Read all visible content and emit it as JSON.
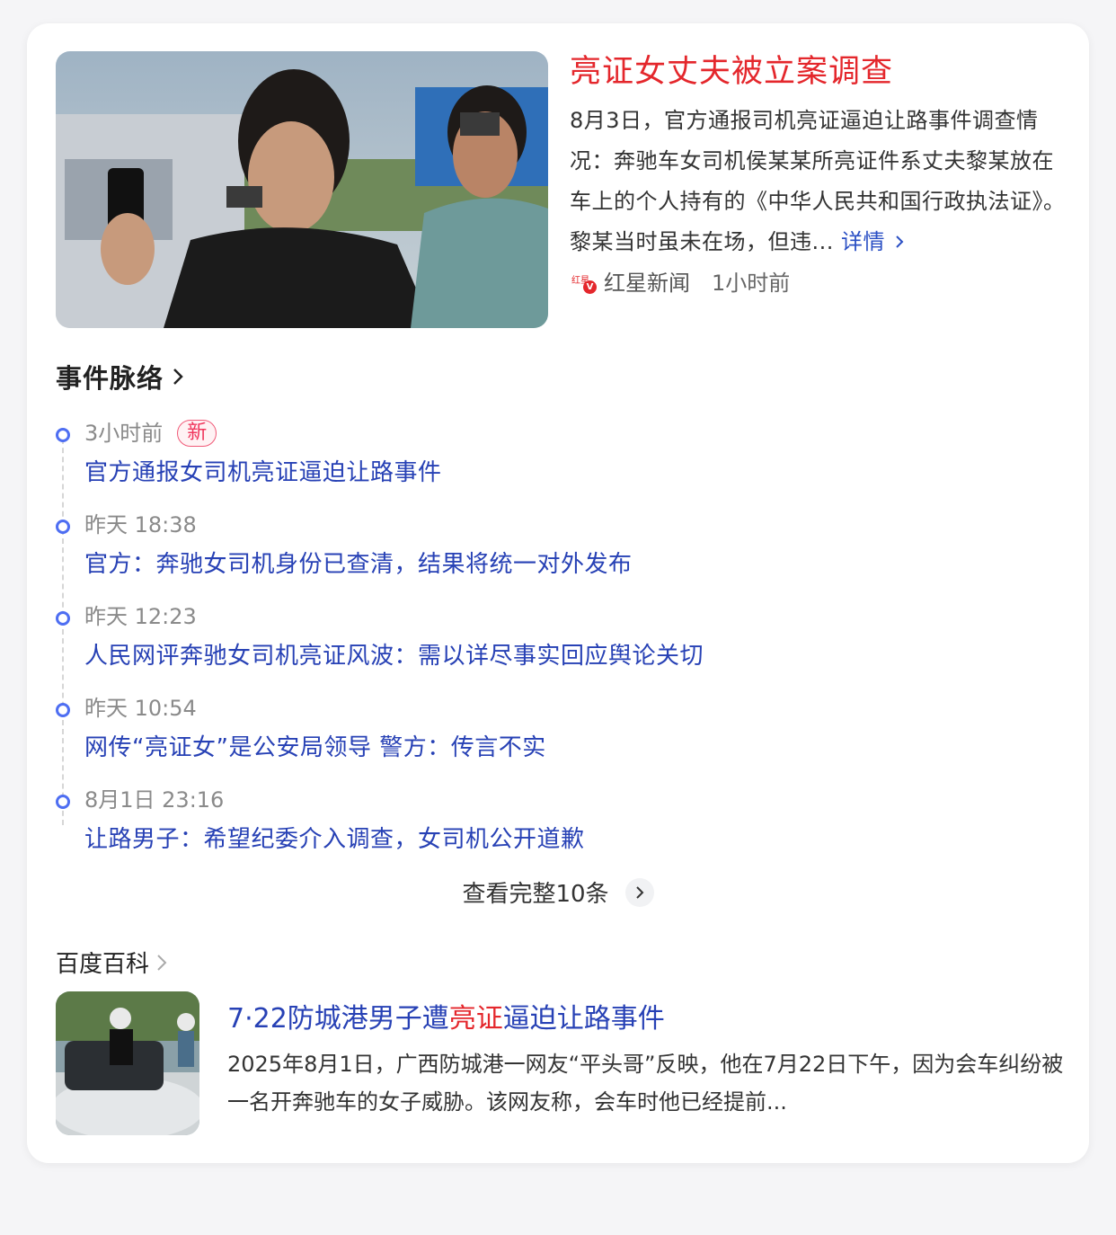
{
  "news": {
    "title": "亮证女丈夫被立案调查",
    "summary": "8月3日，官方通报司机亮证逼迫让路事件调查情况：奔驰车女司机侯某某所亮证件系丈夫黎某放在车上的个人持有的《中华人民共和国行政执法证》。黎某当时虽未在场，但违...",
    "detail_label": "详情",
    "source_name": "红星新闻",
    "time": "1小时前",
    "source_icon": "hongxing-logo-verified-icon"
  },
  "timeline": {
    "heading": "事件脉络",
    "items": [
      {
        "time": "3小时前",
        "badge": "新",
        "text": "官方通报女司机亮证逼迫让路事件"
      },
      {
        "time": "昨天 18:38",
        "text": "官方：奔驰女司机身份已查清，结果将统一对外发布"
      },
      {
        "time": "昨天 12:23",
        "text": "人民网评奔驰女司机亮证风波：需以详尽事实回应舆论关切"
      },
      {
        "time": "昨天 10:54",
        "text": "网传“亮证女”是公安局领导 警方：传言不实"
      },
      {
        "time": "8月1日 23:16",
        "text": "让路男子：希望纪委介入调查，女司机公开道歉"
      }
    ],
    "view_all": "查看完整10条"
  },
  "baike": {
    "heading": "百度百科",
    "title_part1": "7·22防城港男子遭",
    "title_highlight": "亮证",
    "title_part2": "逼迫让路事件",
    "desc": "2025年8月1日，广西防城港一网友“平头哥”反映，他在7月22日下午，因为会车纠纷被一名开奔驰车的女子威胁。该网友称，会车时他已经提前..."
  },
  "colors": {
    "title_red": "#e4272c",
    "link_blue": "#2741b5",
    "dot_blue": "#4e6ef2",
    "badge_pink": "#f0365c"
  }
}
